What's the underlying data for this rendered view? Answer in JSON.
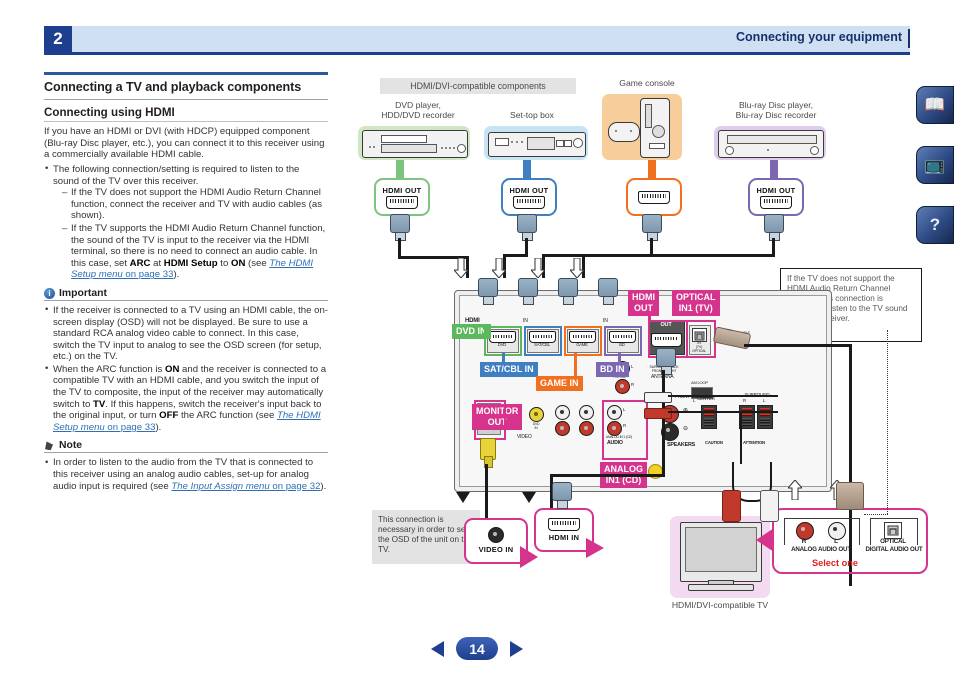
{
  "header": {
    "chapter": "2",
    "title": "Connecting your equipment"
  },
  "footer": {
    "page": "14",
    "prev_icon": "left-triangle-icon",
    "next_icon": "right-triangle-icon"
  },
  "sidebar_tabs": [
    {
      "name": "manual",
      "icon": "open-book-icon",
      "glyph": "📖"
    },
    {
      "name": "remote",
      "icon": "remote-and-tv-icon",
      "glyph": "📺"
    },
    {
      "name": "faq",
      "icon": "question-mark-icon",
      "glyph": "?"
    }
  ],
  "left": {
    "section_title": "Connecting a TV and playback components",
    "subsection_title": "Connecting using HDMI",
    "intro": "If you have an HDMI or DVI (with HDCP) equipped component (Blu-ray Disc player, etc.), you can connect it to this receiver using a commercially available HDMI cable.",
    "bullet1": "The following connection/setting is required to listen to the sound of the TV over this receiver.",
    "dash1": "If the TV does not support the HDMI Audio Return Channel function, connect the receiver and TV with audio cables (as shown).",
    "dash2_a": "If the TV supports the HDMI Audio Return Channel function, the sound of the TV is input to the receiver via the HDMI terminal, so there is no need to connect an audio cable. In this case, set ",
    "dash2_b": "ARC",
    "dash2_c": " at ",
    "dash2_d": "HDMI Setup",
    "dash2_e": " to ",
    "dash2_f": "ON",
    "dash2_g": " (see ",
    "dash2_link_italic": "The HDMI Setup menu",
    "dash2_link_plain": " on page 33",
    "dash2_h": ").",
    "important_heading": "Important",
    "important_b1": "If the receiver is connected to a TV using an HDMI cable, the on-screen display (OSD) will not be displayed. Be sure to use a standard RCA analog video cable to connect. In this case, switch the TV input to analog to see the OSD screen (for setup, etc.) on the TV.",
    "important_b2_a": "When the ARC function is ",
    "important_b2_on": "ON",
    "important_b2_b": " and the receiver is connected to a compatible TV with an HDMI cable, and you switch the input of the TV to composite, the input of the receiver may automatically switch to ",
    "important_b2_tv": "TV",
    "important_b2_c": ". If this happens, switch the receiver's input back to the original input, or turn ",
    "important_b2_off": "OFF",
    "important_b2_d": " the ARC function (see ",
    "important_b2_link_italic": "The HDMI Setup menu",
    "important_b2_link_plain": " on page 33",
    "important_b2_e": ").",
    "note_heading": "Note",
    "note_b1_a": "In order to listen to the audio from the TV that is connected to this receiver using an analog audio cables, set-up for analog audio input is required (see ",
    "note_b1_link_italic": "The Input Assign menu",
    "note_b1_link_plain": " on page 32",
    "note_b1_b": ")."
  },
  "diagram": {
    "band_hdmi_dvi": "HDMI/DVI-compatible components",
    "devices": [
      {
        "id": "dvd",
        "label": "DVD player,\nHDD/DVD recorder",
        "color": "#7ec47e",
        "box_fill": "#cfe8c4",
        "port_caption": "HDMI OUT"
      },
      {
        "id": "settop",
        "label": "Set-top box",
        "color": "#3f7fc1",
        "box_fill": "#c8e4f3",
        "port_caption": "HDMI OUT"
      },
      {
        "id": "game",
        "label": "Game console",
        "color": "#f07020",
        "box_fill": "#f7ce9b",
        "port_caption": ""
      },
      {
        "id": "bluray",
        "label": "Blu-ray Disc player,\nBlu-ray Disc recorder",
        "color": "#7b68b0",
        "box_fill": "#e0cdee",
        "port_caption": "HDMI OUT"
      }
    ],
    "receiver_input_tags": [
      {
        "text": "DVD IN",
        "color": "#5cb85c"
      },
      {
        "text": "SAT/CBL IN",
        "color": "#3f7fc1"
      },
      {
        "text": "GAME IN",
        "color": "#f07020"
      },
      {
        "text": "BD IN",
        "color": "#7b68b0"
      }
    ],
    "receiver_port_micro": [
      "DVD",
      "SAT/CBL",
      "GAME",
      "BD"
    ],
    "tag_hdmi_out": "HDMI\nOUT",
    "tag_optical_in": "OPTICAL\nIN1 (TV)",
    "tag_monitor_out": "MONITOR\nOUT",
    "tag_analog_in": "ANALOG\nIN1 (CD)",
    "panel_hdmi_word": "HDMI",
    "panel_in_word": "IN",
    "panel_out_word": "OUT",
    "panel_optical_micro": "IN\n(TV)\nOPTICAL",
    "panel_monitor_micro": "MONITOR\nOUT",
    "panel_video_word": "VIDEO",
    "panel_audio_word": "AUDIO",
    "panel_analog_micro": "ANALOG IN 1 (CD)",
    "panel_antenna_word": "ANTENNA",
    "panel_amloop_word": "AM LOOP",
    "panel_speakers_word": "SPEAKERS",
    "panel_center_word": "CENTER",
    "panel_surround_word": "SURROUND",
    "panel_front_word": "FRONT",
    "panel_lr": {
      "l": "L",
      "r": "R"
    },
    "panel_preout": "PRE OUT",
    "panel_surback": "SURROUND BACK\nFRONT HEIGHT",
    "panel_caution": "CAUTION",
    "panel_attention": "ATTENTION",
    "callout_arc": "If the TV does not support the HDMI Audio Return Channel function, this connection is required to listen to the TV sound over the receiver.",
    "callout_osd": "This connection is necessary in order to see the OSD of the unit on the TV.",
    "tv_caption": "HDMI/DVI-compatible TV",
    "tv_video_in": "VIDEO IN",
    "tv_hdmi_in": "HDMI IN",
    "tv_analog_audio_out": "ANALOG AUDIO OUT",
    "tv_digital_audio_out": "DIGITAL AUDIO OUT",
    "tv_optical": "OPTICAL",
    "tv_rca_r": "R",
    "tv_rca_l": "L",
    "select_one": "Select one"
  },
  "colors": {
    "brand_blue": "#1e3f8f",
    "header_band": "#cfe0f2",
    "magenta": "#d6338c",
    "green": "#5cb85c",
    "blue": "#3f7fc1",
    "orange": "#f07020",
    "purple": "#7b68b0",
    "red": "#e02020"
  }
}
